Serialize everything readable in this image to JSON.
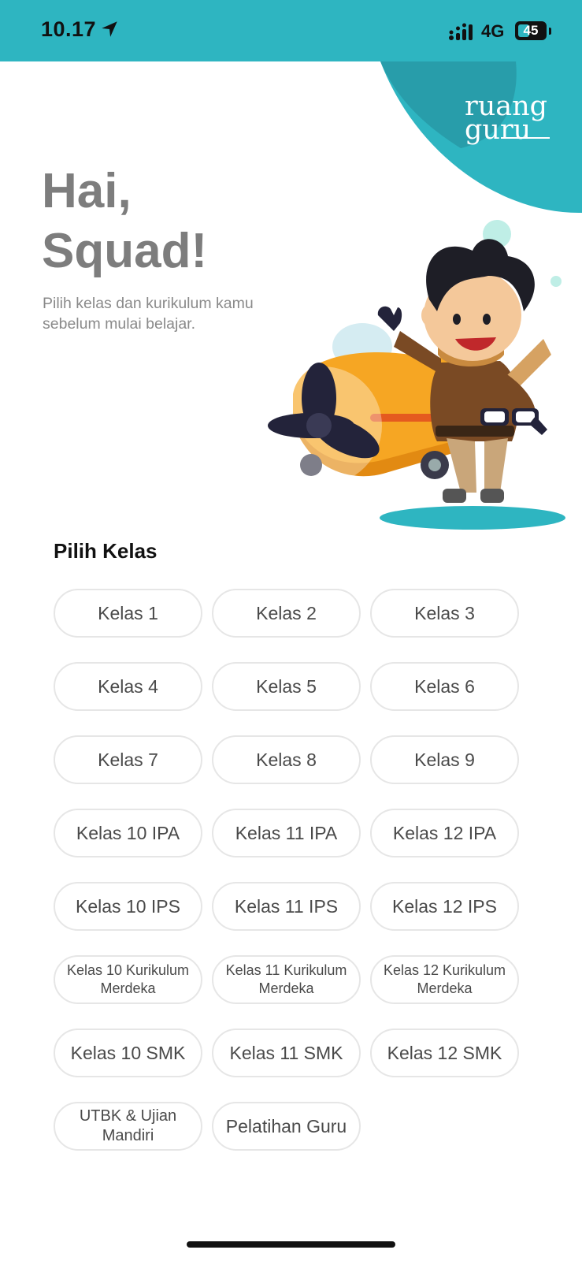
{
  "status_bar": {
    "time": "10.17",
    "network": "4G",
    "battery": "45",
    "battery_level": 0.45
  },
  "brand": {
    "logo_line1": "ruang",
    "logo_line2": "guru",
    "accent_color": "#2eb5c1"
  },
  "hero": {
    "greeting_line1": "Hai,",
    "greeting_line2": "Squad!",
    "subtitle": "Pilih kelas dan kurikulum kamu sebelum mulai belajar."
  },
  "section": {
    "title": "Pilih Kelas"
  },
  "classes": [
    {
      "label": "Kelas 1"
    },
    {
      "label": "Kelas 2"
    },
    {
      "label": "Kelas 3"
    },
    {
      "label": "Kelas 4"
    },
    {
      "label": "Kelas 5"
    },
    {
      "label": "Kelas 6"
    },
    {
      "label": "Kelas 7"
    },
    {
      "label": "Kelas 8"
    },
    {
      "label": "Kelas 9"
    },
    {
      "label": "Kelas 10 IPA"
    },
    {
      "label": "Kelas 11 IPA"
    },
    {
      "label": "Kelas 12 IPA"
    },
    {
      "label": "Kelas 10 IPS"
    },
    {
      "label": "Kelas 11 IPS"
    },
    {
      "label": "Kelas 12 IPS"
    },
    {
      "label": "Kelas 10 Kurikulum Merdeka"
    },
    {
      "label": "Kelas 11 Kurikulum Merdeka"
    },
    {
      "label": "Kelas 12 Kurikulum Merdeka"
    },
    {
      "label": "Kelas 10 SMK"
    },
    {
      "label": "Kelas 11 SMK"
    },
    {
      "label": "Kelas 12 SMK"
    },
    {
      "label": "UTBK & Ujian Mandiri"
    },
    {
      "label": "Pelatihan Guru"
    }
  ]
}
